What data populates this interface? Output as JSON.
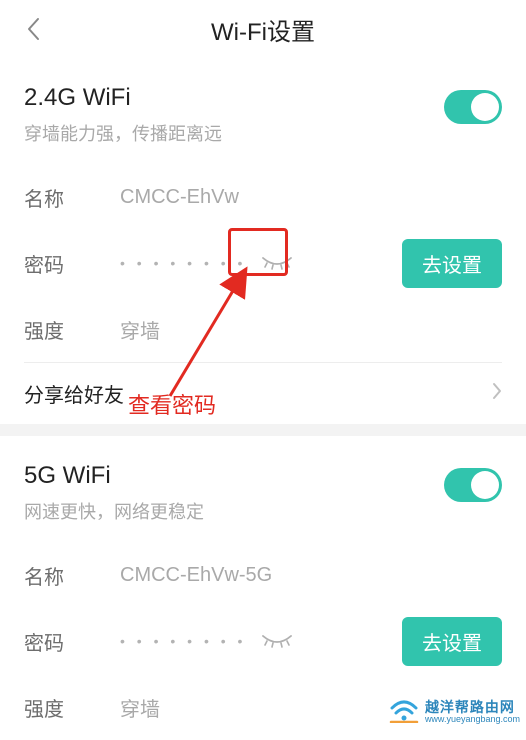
{
  "header": {
    "title": "Wi-Fi设置"
  },
  "wifi24": {
    "title": "2.4G WiFi",
    "desc": "穿墙能力强，传播距离远",
    "toggle": true,
    "name_label": "名称",
    "name_value": "CMCC-EhVw",
    "password_label": "密码",
    "password_dots": "• • • • • • • •",
    "go_settings_label": "去设置",
    "strength_label": "强度",
    "strength_value": "穿墙",
    "share_label": "分享给好友"
  },
  "wifi5": {
    "title": "5G WiFi",
    "desc": "网速更快，网络更稳定",
    "toggle": true,
    "name_label": "名称",
    "name_value": "CMCC-EhVw-5G",
    "password_label": "密码",
    "password_dots": "• • • • • • • •",
    "go_settings_label": "去设置",
    "strength_label": "强度",
    "strength_value": "穿墙"
  },
  "annotation": {
    "label": "查看密码"
  },
  "watermark": {
    "line1": "越洋帮路由网",
    "line2": "www.yueyangbang.com"
  }
}
